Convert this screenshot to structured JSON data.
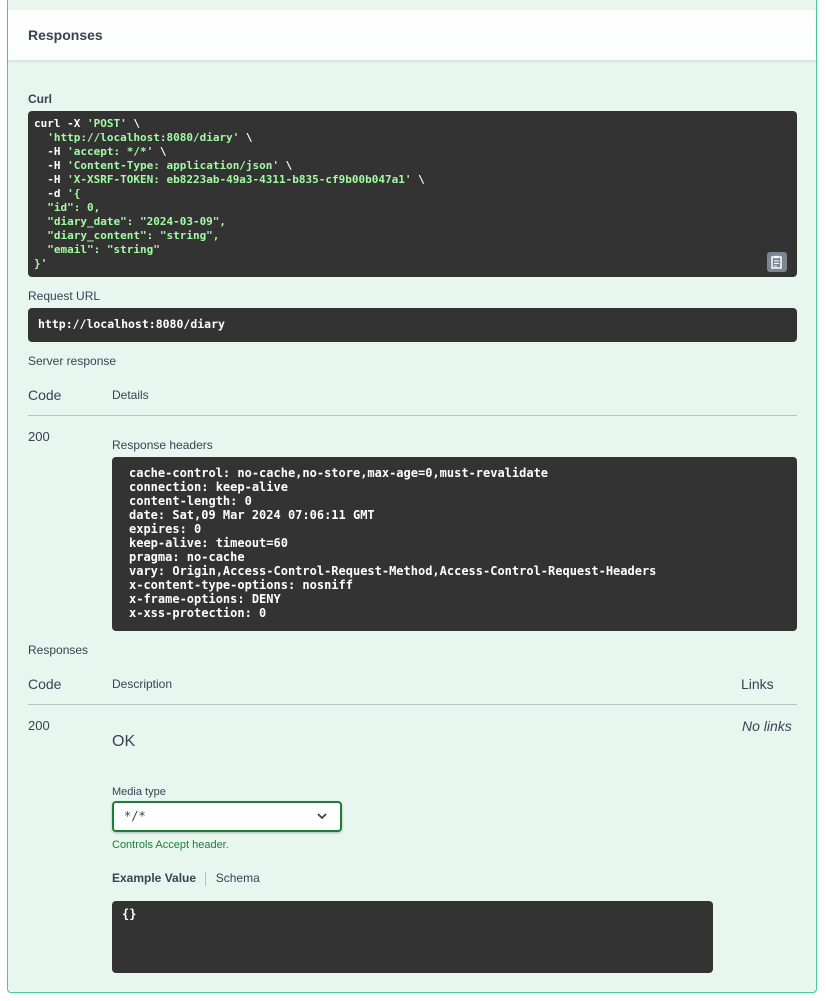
{
  "section": {
    "title": "Responses"
  },
  "curl": {
    "label": "Curl",
    "lines": [
      [
        {
          "t": "curl -X ",
          "c": "w"
        },
        {
          "t": "'POST'",
          "c": "g"
        },
        {
          "t": " \\",
          "c": "w"
        }
      ],
      [
        {
          "t": "  ",
          "c": "w"
        },
        {
          "t": "'http://localhost:8080/diary'",
          "c": "g"
        },
        {
          "t": " \\",
          "c": "w"
        }
      ],
      [
        {
          "t": "  -H ",
          "c": "w"
        },
        {
          "t": "'accept: */*'",
          "c": "g"
        },
        {
          "t": " \\",
          "c": "w"
        }
      ],
      [
        {
          "t": "  -H ",
          "c": "w"
        },
        {
          "t": "'Content-Type: application/json'",
          "c": "g"
        },
        {
          "t": " \\",
          "c": "w"
        }
      ],
      [
        {
          "t": "  -H ",
          "c": "w"
        },
        {
          "t": "'X-XSRF-TOKEN: eb8223ab-49a3-4311-b835-cf9b00b047a1'",
          "c": "g"
        },
        {
          "t": " \\",
          "c": "w"
        }
      ],
      [
        {
          "t": "  -d ",
          "c": "w"
        },
        {
          "t": "'{",
          "c": "g"
        }
      ],
      [
        {
          "t": "  \"id\": 0,",
          "c": "g"
        }
      ],
      [
        {
          "t": "  \"diary_date\": \"2024-03-09\",",
          "c": "g"
        }
      ],
      [
        {
          "t": "  \"diary_content\": \"string\",",
          "c": "g"
        }
      ],
      [
        {
          "t": "  \"email\": \"string\"",
          "c": "g"
        }
      ],
      [
        {
          "t": "}'",
          "c": "g"
        }
      ]
    ]
  },
  "request_url": {
    "label": "Request URL",
    "value": "http://localhost:8080/diary"
  },
  "server_response": {
    "label": "Server response",
    "col_code": "Code",
    "col_details": "Details",
    "code": "200",
    "headers_label": "Response headers",
    "headers": [
      "cache-control: no-cache,no-store,max-age=0,must-revalidate",
      "connection: keep-alive",
      "content-length: 0",
      "date: Sat,09 Mar 2024 07:06:11 GMT",
      "expires: 0",
      "keep-alive: timeout=60",
      "pragma: no-cache",
      "vary: Origin,Access-Control-Request-Method,Access-Control-Request-Headers",
      "x-content-type-options: nosniff",
      "x-frame-options: DENY",
      "x-xss-protection: 0"
    ]
  },
  "responses": {
    "label": "Responses",
    "col_code": "Code",
    "col_description": "Description",
    "col_links": "Links",
    "code": "200",
    "description": "OK",
    "links": "No links",
    "media_type_label": "Media type",
    "media_type_value": "*/*",
    "controls_note": "Controls Accept header.",
    "tab_example": "Example Value",
    "tab_schema": "Schema",
    "example": "{}"
  },
  "colors": {
    "accent": "#49cc90",
    "code_bg": "#333333",
    "code_string": "#a2fca2",
    "select_border": "#1d7e3a"
  }
}
